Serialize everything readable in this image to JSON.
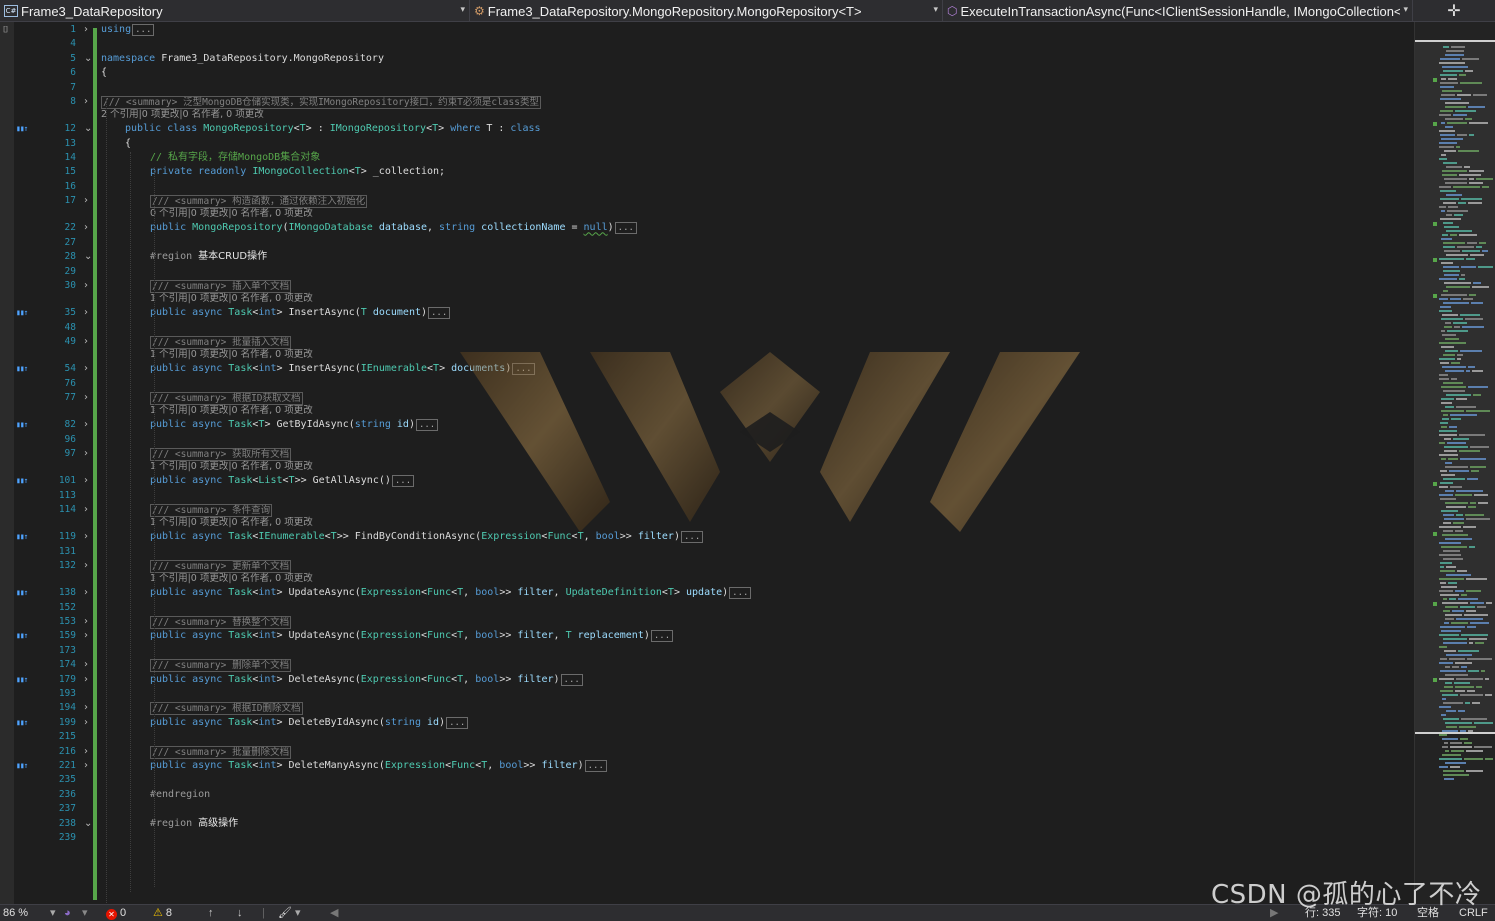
{
  "navbar": {
    "project": "Frame3_DataRepository",
    "class_path": "Frame3_DataRepository.MongoRepository.MongoRepository<T>",
    "member": "ExecuteInTransactionAsync(Func<IClientSessionHandle, IMongoCollection<",
    "dropdown_glyph": "▾",
    "split_glyph": "✛"
  },
  "lines": [
    {
      "n": "1",
      "fold": "›",
      "parts": [
        {
          "c": "kw",
          "t": "using"
        }
      ],
      "ellipsis": true
    },
    {
      "n": "4"
    },
    {
      "n": "5",
      "fold": "⌄",
      "parts": [
        {
          "c": "kw",
          "t": "namespace"
        },
        {
          "c": "pl",
          "t": " Frame3_DataRepository.MongoRepository"
        }
      ]
    },
    {
      "n": "6",
      "parts": [
        {
          "c": "pl",
          "t": "{"
        }
      ]
    },
    {
      "n": "7"
    },
    {
      "n": "8",
      "fold": "›",
      "summary": "/// <summary> 泛型MongoDB仓储实现类，实现IMongoRepository接口，约束T必须是class类型",
      "lens": "2 个引用|0 项更改|0 名作者, 0 项更改"
    },
    {
      "n": "12",
      "ref": true,
      "fold": "⌄",
      "parts": [
        {
          "c": "kw",
          "t": "public class "
        },
        {
          "c": "ty",
          "t": "MongoRepository"
        },
        {
          "c": "pl",
          "t": "<"
        },
        {
          "c": "ty",
          "t": "T"
        },
        {
          "c": "pl",
          "t": "> : "
        },
        {
          "c": "ty",
          "t": "IMongoRepository"
        },
        {
          "c": "pl",
          "t": "<"
        },
        {
          "c": "ty",
          "t": "T"
        },
        {
          "c": "pl",
          "t": "> "
        },
        {
          "c": "kw",
          "t": "where"
        },
        {
          "c": "pl",
          "t": " T : "
        },
        {
          "c": "kw",
          "t": "class"
        }
      ]
    },
    {
      "n": "13",
      "parts": [
        {
          "c": "pl",
          "t": "{"
        }
      ]
    },
    {
      "n": "14",
      "parts": [
        {
          "c": "cm",
          "t": "// 私有字段，存储MongoDB集合对象"
        }
      ]
    },
    {
      "n": "15",
      "parts": [
        {
          "c": "kw",
          "t": "private readonly "
        },
        {
          "c": "ty",
          "t": "IMongoCollection"
        },
        {
          "c": "pl",
          "t": "<"
        },
        {
          "c": "ty",
          "t": "T"
        },
        {
          "c": "pl",
          "t": "> _collection;"
        }
      ]
    },
    {
      "n": "16"
    },
    {
      "n": "17",
      "fold": "›",
      "summary": "/// <summary> 构造函数，通过依赖注入初始化",
      "lens": "0 个引用|0 项更改|0 名作者, 0 项更改"
    },
    {
      "n": "22",
      "fold": "›",
      "parts": [
        {
          "c": "kw",
          "t": "public "
        },
        {
          "c": "ty",
          "t": "MongoRepository"
        },
        {
          "c": "pl",
          "t": "("
        },
        {
          "c": "ty",
          "t": "IMongoDatabase"
        },
        {
          "c": "pm",
          "t": " database"
        },
        {
          "c": "pl",
          "t": ", "
        },
        {
          "c": "kw",
          "t": "string"
        },
        {
          "c": "pm",
          "t": " collectionName"
        },
        {
          "c": "pl",
          "t": " = "
        },
        {
          "c": "kw",
          "t": "null"
        },
        {
          "c": "pl",
          "t": ")"
        }
      ],
      "ellipsis": true
    },
    {
      "n": "27"
    },
    {
      "n": "28",
      "fold": "⌄",
      "region": true,
      "pre": "#region ",
      "pre_text": "基本CRUD操作"
    },
    {
      "n": "29"
    },
    {
      "n": "30",
      "fold": "›",
      "summary": "/// <summary> 插入单个文档",
      "lens": "1 个引用|0 项更改|0 名作者, 0 项更改"
    },
    {
      "n": "35",
      "ref": true,
      "fold": "›",
      "parts": [
        {
          "c": "kw",
          "t": "public async "
        },
        {
          "c": "ty",
          "t": "Task"
        },
        {
          "c": "pl",
          "t": "<"
        },
        {
          "c": "kw",
          "t": "int"
        },
        {
          "c": "pl",
          "t": "> InsertAsync("
        },
        {
          "c": "ty",
          "t": "T"
        },
        {
          "c": "pm",
          "t": " document"
        },
        {
          "c": "pl",
          "t": ")"
        }
      ],
      "ellipsis": true
    },
    {
      "n": "48"
    },
    {
      "n": "49",
      "fold": "›",
      "summary": "/// <summary> 批量插入文档",
      "lens": "1 个引用|0 项更改|0 名作者, 0 项更改"
    },
    {
      "n": "54",
      "ref": true,
      "fold": "›",
      "parts": [
        {
          "c": "kw",
          "t": "public async "
        },
        {
          "c": "ty",
          "t": "Task"
        },
        {
          "c": "pl",
          "t": "<"
        },
        {
          "c": "kw",
          "t": "int"
        },
        {
          "c": "pl",
          "t": "> InsertAsync("
        },
        {
          "c": "ty",
          "t": "IEnumerable"
        },
        {
          "c": "pl",
          "t": "<"
        },
        {
          "c": "ty",
          "t": "T"
        },
        {
          "c": "pl",
          "t": ">"
        },
        {
          "c": "pm",
          "t": " documents"
        },
        {
          "c": "pl",
          "t": ")"
        }
      ],
      "ellipsis": true
    },
    {
      "n": "76"
    },
    {
      "n": "77",
      "fold": "›",
      "summary": "/// <summary> 根据ID获取文档",
      "lens": "1 个引用|0 项更改|0 名作者, 0 项更改"
    },
    {
      "n": "82",
      "ref": true,
      "fold": "›",
      "parts": [
        {
          "c": "kw",
          "t": "public async "
        },
        {
          "c": "ty",
          "t": "Task"
        },
        {
          "c": "pl",
          "t": "<"
        },
        {
          "c": "ty",
          "t": "T"
        },
        {
          "c": "pl",
          "t": "> GetByIdAsync("
        },
        {
          "c": "kw",
          "t": "string"
        },
        {
          "c": "pm",
          "t": " id"
        },
        {
          "c": "pl",
          "t": ")"
        }
      ],
      "ellipsis": true
    },
    {
      "n": "96"
    },
    {
      "n": "97",
      "fold": "›",
      "summary": "/// <summary> 获取所有文档",
      "lens": "1 个引用|0 项更改|0 名作者, 0 项更改"
    },
    {
      "n": "101",
      "ref": true,
      "fold": "›",
      "parts": [
        {
          "c": "kw",
          "t": "public async "
        },
        {
          "c": "ty",
          "t": "Task"
        },
        {
          "c": "pl",
          "t": "<"
        },
        {
          "c": "ty",
          "t": "List"
        },
        {
          "c": "pl",
          "t": "<"
        },
        {
          "c": "ty",
          "t": "T"
        },
        {
          "c": "pl",
          "t": ">> GetAllAsync()"
        }
      ],
      "ellipsis": true
    },
    {
      "n": "113"
    },
    {
      "n": "114",
      "fold": "›",
      "summary": "/// <summary> 条件查询",
      "lens": "1 个引用|0 项更改|0 名作者, 0 项更改"
    },
    {
      "n": "119",
      "ref": true,
      "fold": "›",
      "parts": [
        {
          "c": "kw",
          "t": "public async "
        },
        {
          "c": "ty",
          "t": "Task"
        },
        {
          "c": "pl",
          "t": "<"
        },
        {
          "c": "ty",
          "t": "IEnumerable"
        },
        {
          "c": "pl",
          "t": "<"
        },
        {
          "c": "ty",
          "t": "T"
        },
        {
          "c": "pl",
          "t": ">> FindByConditionAsync("
        },
        {
          "c": "ty",
          "t": "Expression"
        },
        {
          "c": "pl",
          "t": "<"
        },
        {
          "c": "ty",
          "t": "Func"
        },
        {
          "c": "pl",
          "t": "<"
        },
        {
          "c": "ty",
          "t": "T"
        },
        {
          "c": "pl",
          "t": ", "
        },
        {
          "c": "kw",
          "t": "bool"
        },
        {
          "c": "pl",
          "t": ">>"
        },
        {
          "c": "pm",
          "t": " filter"
        },
        {
          "c": "pl",
          "t": ")"
        }
      ],
      "ellipsis": true
    },
    {
      "n": "131"
    },
    {
      "n": "132",
      "fold": "›",
      "summary": "/// <summary> 更新单个文档",
      "lens": "1 个引用|0 项更改|0 名作者, 0 项更改"
    },
    {
      "n": "138",
      "ref": true,
      "fold": "›",
      "parts": [
        {
          "c": "kw",
          "t": "public async "
        },
        {
          "c": "ty",
          "t": "Task"
        },
        {
          "c": "pl",
          "t": "<"
        },
        {
          "c": "kw",
          "t": "int"
        },
        {
          "c": "pl",
          "t": "> UpdateAsync("
        },
        {
          "c": "ty",
          "t": "Expression"
        },
        {
          "c": "pl",
          "t": "<"
        },
        {
          "c": "ty",
          "t": "Func"
        },
        {
          "c": "pl",
          "t": "<"
        },
        {
          "c": "ty",
          "t": "T"
        },
        {
          "c": "pl",
          "t": ", "
        },
        {
          "c": "kw",
          "t": "bool"
        },
        {
          "c": "pl",
          "t": ">>"
        },
        {
          "c": "pm",
          "t": " filter"
        },
        {
          "c": "pl",
          "t": ", "
        },
        {
          "c": "ty",
          "t": "UpdateDefinition"
        },
        {
          "c": "pl",
          "t": "<"
        },
        {
          "c": "ty",
          "t": "T"
        },
        {
          "c": "pl",
          "t": ">"
        },
        {
          "c": "pm",
          "t": " update"
        },
        {
          "c": "pl",
          "t": ")"
        }
      ],
      "ellipsis": true
    },
    {
      "n": "152"
    },
    {
      "n": "153",
      "fold": "›",
      "summary": "/// <summary> 替换整个文档"
    },
    {
      "n": "159",
      "ref": true,
      "fold": "›",
      "parts": [
        {
          "c": "kw",
          "t": "public async "
        },
        {
          "c": "ty",
          "t": "Task"
        },
        {
          "c": "pl",
          "t": "<"
        },
        {
          "c": "kw",
          "t": "int"
        },
        {
          "c": "pl",
          "t": "> UpdateAsync("
        },
        {
          "c": "ty",
          "t": "Expression"
        },
        {
          "c": "pl",
          "t": "<"
        },
        {
          "c": "ty",
          "t": "Func"
        },
        {
          "c": "pl",
          "t": "<"
        },
        {
          "c": "ty",
          "t": "T"
        },
        {
          "c": "pl",
          "t": ", "
        },
        {
          "c": "kw",
          "t": "bool"
        },
        {
          "c": "pl",
          "t": ">>"
        },
        {
          "c": "pm",
          "t": " filter"
        },
        {
          "c": "pl",
          "t": ", "
        },
        {
          "c": "ty",
          "t": "T"
        },
        {
          "c": "pm",
          "t": " replacement"
        },
        {
          "c": "pl",
          "t": ")"
        }
      ],
      "ellipsis": true
    },
    {
      "n": "173"
    },
    {
      "n": "174",
      "fold": "›",
      "summary": "/// <summary> 删除单个文档"
    },
    {
      "n": "179",
      "ref": true,
      "fold": "›",
      "parts": [
        {
          "c": "kw",
          "t": "public async "
        },
        {
          "c": "ty",
          "t": "Task"
        },
        {
          "c": "pl",
          "t": "<"
        },
        {
          "c": "kw",
          "t": "int"
        },
        {
          "c": "pl",
          "t": "> DeleteAsync("
        },
        {
          "c": "ty",
          "t": "Expression"
        },
        {
          "c": "pl",
          "t": "<"
        },
        {
          "c": "ty",
          "t": "Func"
        },
        {
          "c": "pl",
          "t": "<"
        },
        {
          "c": "ty",
          "t": "T"
        },
        {
          "c": "pl",
          "t": ", "
        },
        {
          "c": "kw",
          "t": "bool"
        },
        {
          "c": "pl",
          "t": ">>"
        },
        {
          "c": "pm",
          "t": " filter"
        },
        {
          "c": "pl",
          "t": ")"
        }
      ],
      "ellipsis": true
    },
    {
      "n": "193"
    },
    {
      "n": "194",
      "fold": "›",
      "summary": "/// <summary> 根据ID删除文档"
    },
    {
      "n": "199",
      "ref": true,
      "fold": "›",
      "parts": [
        {
          "c": "kw",
          "t": "public async "
        },
        {
          "c": "ty",
          "t": "Task"
        },
        {
          "c": "pl",
          "t": "<"
        },
        {
          "c": "kw",
          "t": "int"
        },
        {
          "c": "pl",
          "t": "> DeleteByIdAsync("
        },
        {
          "c": "kw",
          "t": "string"
        },
        {
          "c": "pm",
          "t": " id"
        },
        {
          "c": "pl",
          "t": ")"
        }
      ],
      "ellipsis": true
    },
    {
      "n": "215"
    },
    {
      "n": "216",
      "fold": "›",
      "summary": "/// <summary> 批量删除文档"
    },
    {
      "n": "221",
      "ref": true,
      "fold": "›",
      "parts": [
        {
          "c": "kw",
          "t": "public async "
        },
        {
          "c": "ty",
          "t": "Task"
        },
        {
          "c": "pl",
          "t": "<"
        },
        {
          "c": "kw",
          "t": "int"
        },
        {
          "c": "pl",
          "t": "> DeleteManyAsync("
        },
        {
          "c": "ty",
          "t": "Expression"
        },
        {
          "c": "pl",
          "t": "<"
        },
        {
          "c": "ty",
          "t": "Func"
        },
        {
          "c": "pl",
          "t": "<"
        },
        {
          "c": "ty",
          "t": "T"
        },
        {
          "c": "pl",
          "t": ", "
        },
        {
          "c": "kw",
          "t": "bool"
        },
        {
          "c": "pl",
          "t": ">>"
        },
        {
          "c": "pm",
          "t": " filter"
        },
        {
          "c": "pl",
          "t": ")"
        }
      ],
      "ellipsis": true
    },
    {
      "n": "235"
    },
    {
      "n": "236",
      "pre": "#endregion"
    },
    {
      "n": "237"
    },
    {
      "n": "238",
      "fold": "⌄",
      "pre": "#region ",
      "pre_text": "高级操作"
    },
    {
      "n": "239"
    }
  ],
  "ellipsis_text": "...",
  "status": {
    "zoom": "86 %",
    "errors": "0",
    "warnings": "8",
    "line": "行: 335",
    "char": "字符: 10",
    "spaces": "空格",
    "eol": "CRLF"
  },
  "watermark": "CSDN @孤的心了不冷",
  "colors": {
    "keyword": "#569cd6",
    "type": "#4ec9b0",
    "param": "#9cdcfe",
    "comment": "#57a64a",
    "line_number": "#2b91af",
    "change_bar": "#57a64a"
  }
}
